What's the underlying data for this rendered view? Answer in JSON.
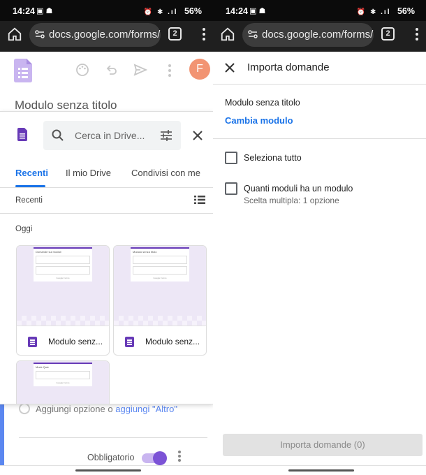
{
  "status": {
    "time": "14:24",
    "battery": "56%",
    "left_icons": "▣ ☗",
    "right_icons": "⏰ ✱ .ıl"
  },
  "browser": {
    "url": "docs.google.com/forms/",
    "tab_count": "2"
  },
  "left": {
    "avatar_letter": "F",
    "background_title": "Modulo senza titolo",
    "picker": {
      "search_placeholder": "Cerca in Drive...",
      "tabs": [
        "Recenti",
        "Il mio Drive",
        "Condivisi con me"
      ],
      "section_label": "Recenti",
      "group_label": "Oggi",
      "cards": [
        {
          "name": "Modulo senz...",
          "thumb_title": "Domande sui moduli"
        },
        {
          "name": "Modulo senz...",
          "thumb_title": "Modulo senza titolo"
        },
        {
          "name": "",
          "thumb_title": "Mock Quiz"
        }
      ]
    },
    "background_bottom": {
      "add_option": "Aggiungi opzione",
      "or_text": "o",
      "add_other": "aggiungi \"Altro\"",
      "required_label": "Obbligatorio"
    }
  },
  "right": {
    "title": "Importa domande",
    "form_title": "Modulo senza titolo",
    "change_form": "Cambia modulo",
    "select_all": "Seleziona tutto",
    "question_title": "Quanti moduli ha un modulo",
    "question_type": "Scelta multipla: 1 opzione",
    "import_button": "Importa domande (0)"
  },
  "colors": {
    "accent_blue": "#1a73e8",
    "forms_purple": "#673ab7",
    "avatar": "#f29473"
  }
}
